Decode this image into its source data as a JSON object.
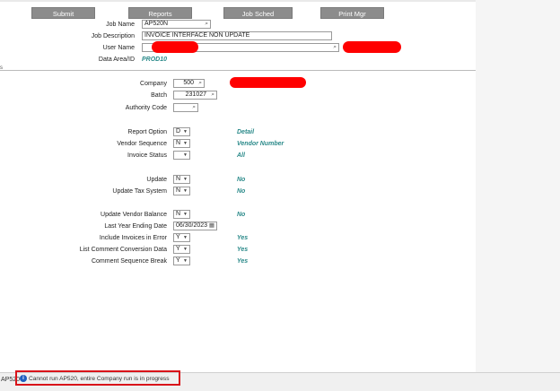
{
  "toolbar": {
    "submit": "Submit",
    "reports": "Reports",
    "job_sched": "Job Sched",
    "print_mgr": "Print Mgr"
  },
  "header": {
    "job_name_label": "Job Name",
    "job_name_value": "AP520N",
    "job_desc_label": "Job Description",
    "job_desc_value": "INVOICE INTERFACE NON UPDATE",
    "user_name_label": "User Name",
    "data_area_label": "Data Area/ID",
    "data_area_value": "PROD10"
  },
  "params": {
    "company_label": "Company",
    "company_value": "500",
    "batch_label": "Batch",
    "batch_value": "231027",
    "authority_label": "Authority Code",
    "report_option_label": "Report Option",
    "report_option_value": "D",
    "report_option_desc": "Detail",
    "vendor_seq_label": "Vendor Sequence",
    "vendor_seq_value": "N",
    "vendor_seq_desc": "Vendor Number",
    "invoice_status_label": "Invoice Status",
    "invoice_status_value": "",
    "invoice_status_desc": "All",
    "update_label": "Update",
    "update_value": "N",
    "update_desc": "No",
    "update_tax_label": "Update Tax System",
    "update_tax_value": "N",
    "update_tax_desc": "No",
    "update_vendor_bal_label": "Update Vendor Balance",
    "update_vendor_bal_value": "N",
    "update_vendor_bal_desc": "No",
    "last_year_end_label": "Last Year Ending Date",
    "last_year_end_value": "06/30/2023",
    "include_err_label": "Include Invoices in Error",
    "include_err_value": "Y",
    "include_err_desc": "Yes",
    "list_comment_label": "List Comment Conversion Data",
    "list_comment_value": "Y",
    "list_comment_desc": "Yes",
    "comment_seq_label": "Comment Sequence Break",
    "comment_seq_value": "Y",
    "comment_seq_desc": "Yes"
  },
  "status": {
    "program": "AP520",
    "message": "Cannot run AP520, entire Company run is in progress"
  },
  "icons": {
    "search": "magnifier-icon",
    "info": "info-icon",
    "calendar": "calendar-icon",
    "dropdown": "chevron-down-icon"
  },
  "colors": {
    "value_text": "#2b8a8a",
    "toolbar_button": "#8c8c8c",
    "redaction": "#ff0000",
    "highlight_box": "#d9141a"
  }
}
